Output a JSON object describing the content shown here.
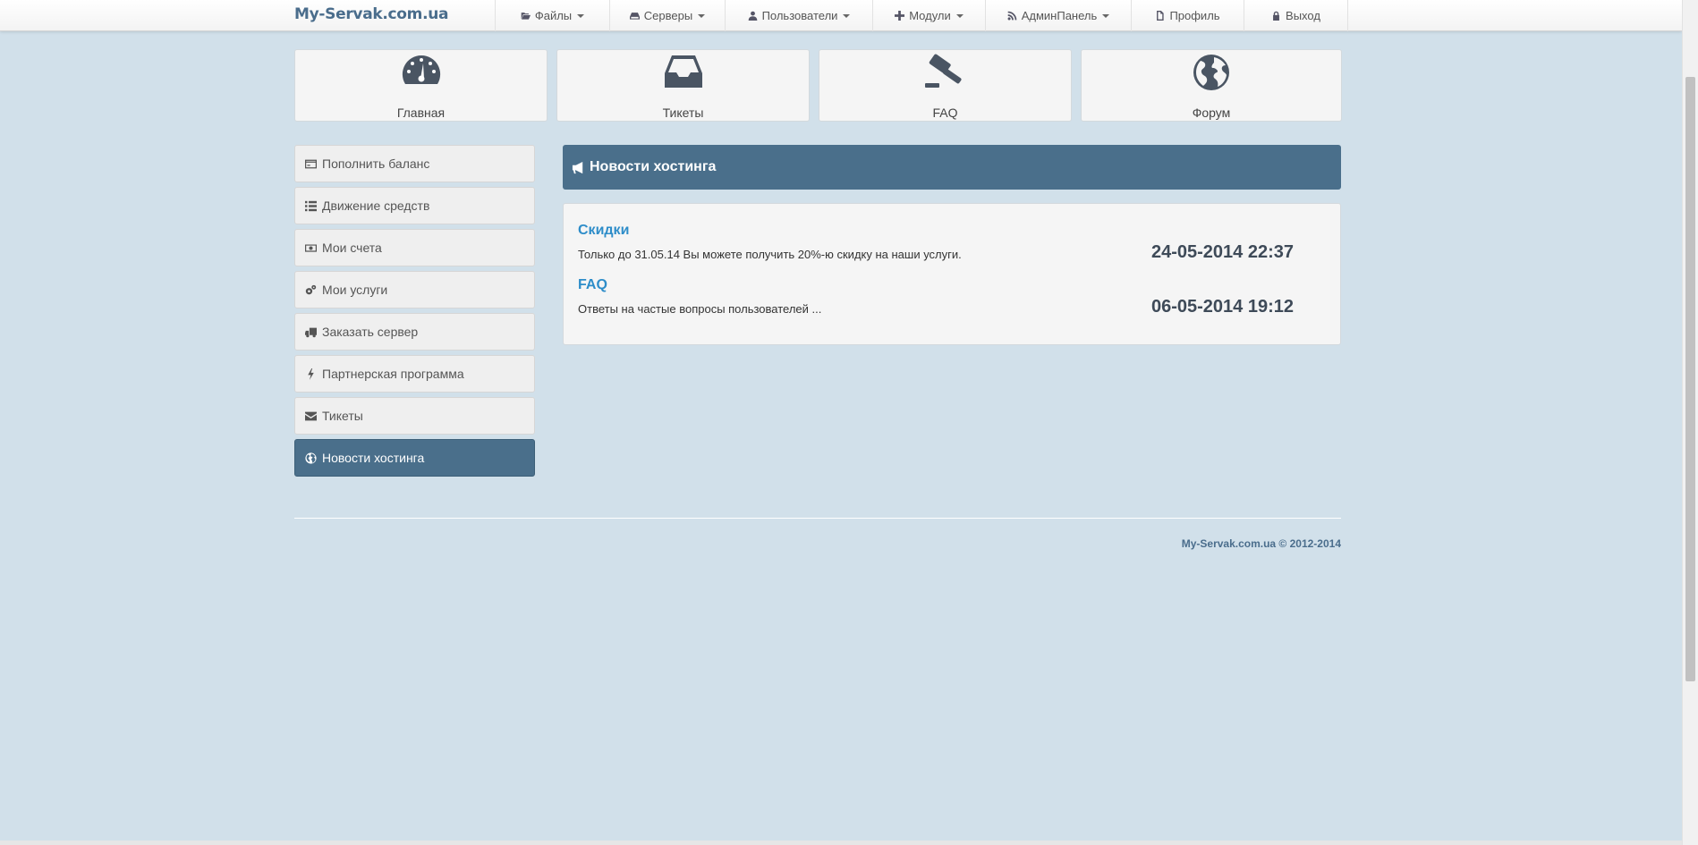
{
  "navbar": {
    "brand": "My-Servak.com.ua",
    "items": [
      {
        "label": "Файлы",
        "icon": "folder-open-icon",
        "caret": true
      },
      {
        "label": "Серверы",
        "icon": "hdd-icon",
        "caret": true
      },
      {
        "label": "Пользователи",
        "icon": "user-icon",
        "caret": true
      },
      {
        "label": "Модули",
        "icon": "plus-icon",
        "caret": true
      },
      {
        "label": "АдминПанель",
        "icon": "rss-icon",
        "caret": true
      },
      {
        "label": "Профиль",
        "icon": "file-icon",
        "caret": false
      },
      {
        "label": "Выход",
        "icon": "lock-icon",
        "caret": false
      }
    ]
  },
  "tiles": [
    {
      "label": "Главная",
      "icon": "dashboard-icon"
    },
    {
      "label": "Тикеты",
      "icon": "inbox-icon"
    },
    {
      "label": "FAQ",
      "icon": "gavel-icon"
    },
    {
      "label": "Форум",
      "icon": "globe-icon"
    }
  ],
  "sidebar": {
    "items": [
      {
        "label": "Пополнить баланс",
        "icon": "credit-card-icon"
      },
      {
        "label": "Движение средств",
        "icon": "list-icon"
      },
      {
        "label": "Мои счета",
        "icon": "money-icon"
      },
      {
        "label": "Мои услуги",
        "icon": "cogs-icon"
      },
      {
        "label": "Заказать сервер",
        "icon": "truck-icon"
      },
      {
        "label": "Партнерская программа",
        "icon": "bolt-icon"
      },
      {
        "label": "Тикеты",
        "icon": "envelope-icon"
      },
      {
        "label": "Новости хостинга",
        "icon": "globe-icon",
        "active": true
      }
    ]
  },
  "main": {
    "title": "Новости хостинга",
    "news": [
      {
        "title": "Скидки",
        "text": "Только до 31.05.14 Вы можете получить 20%-ю скидку на наши услуги.",
        "date": "24-05-2014 22:37"
      },
      {
        "title": "FAQ",
        "text": "Ответы на частые вопросы пользователей ...",
        "date": "06-05-2014 19:12"
      }
    ]
  },
  "footer": {
    "text": "My-Servak.com.ua © 2012-2014"
  },
  "colors": {
    "background": "#d1e0ea",
    "accent": "#4a6f8b",
    "link": "#2e8dc9"
  }
}
